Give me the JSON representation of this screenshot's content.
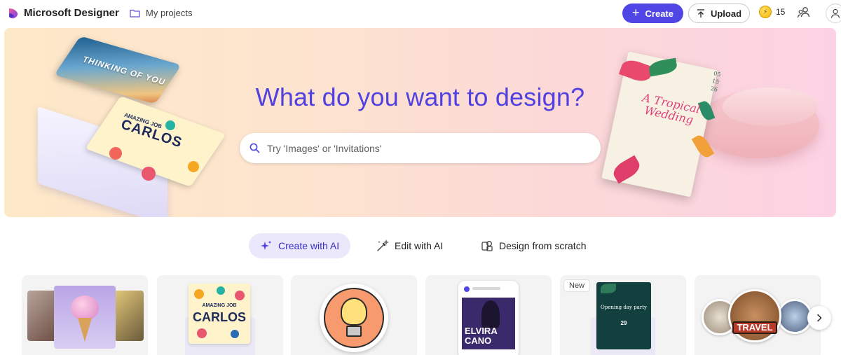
{
  "app": {
    "title": "Microsoft Designer"
  },
  "nav": {
    "projects_label": "My projects"
  },
  "toolbar": {
    "create_label": "Create",
    "upload_label": "Upload",
    "credits": "15"
  },
  "hero": {
    "title": "What do you want to design?",
    "search_placeholder": "Try 'Images' or 'Invitations'",
    "art": {
      "sky_card_text": "THINKING OF YOU",
      "carlos_card_top": "AMAZING JOB",
      "carlos_card_name": "CARLOS",
      "invite_title": "A Tropical Wedding",
      "invite_date": "05\n15\n26"
    }
  },
  "modes": [
    {
      "label": "Create with AI",
      "icon": "sparkle-icon",
      "active": true
    },
    {
      "label": "Edit with AI",
      "icon": "magic-wand-icon",
      "active": false
    },
    {
      "label": "Design from scratch",
      "icon": "design-shapes-icon",
      "active": false
    }
  ],
  "templates": {
    "card2": {
      "top": "AMAZING JOB",
      "name": "CARLOS"
    },
    "card4": {
      "name_line1": "ELVIRA",
      "name_line2": "CANO"
    },
    "card5": {
      "badge": "New",
      "title": "Opening day party",
      "date": "29"
    },
    "card6": {
      "sticker_text": "TRAVEL"
    }
  },
  "colors": {
    "accent": "#4f46e5",
    "hero_title": "#5141e0",
    "active_tab_bg": "#ebe8fb"
  }
}
